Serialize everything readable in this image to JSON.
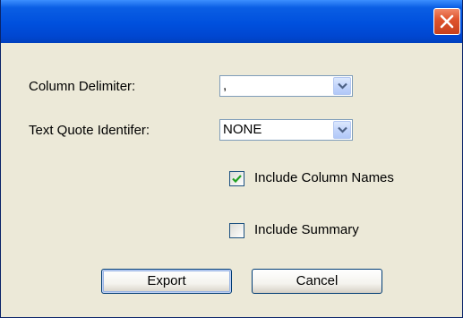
{
  "dialog": {
    "title": "",
    "column_delimiter": {
      "label": "Column Delimiter:",
      "value": ","
    },
    "text_quote": {
      "label": "Text Quote Identifer:",
      "value": "NONE"
    },
    "include_column_names": {
      "label": "Include Column Names",
      "checked": true
    },
    "include_summary": {
      "label": "Include Summary",
      "checked": false
    },
    "export_label": "Export",
    "cancel_label": "Cancel"
  },
  "colors": {
    "titlebar": "#0050dd",
    "close_button": "#e0552f",
    "dialog_background": "#ece9d8",
    "checkmark": "#21a121"
  },
  "icons": {
    "close": "close-icon",
    "dropdown": "chevron-down-icon",
    "check": "checkmark-icon"
  }
}
